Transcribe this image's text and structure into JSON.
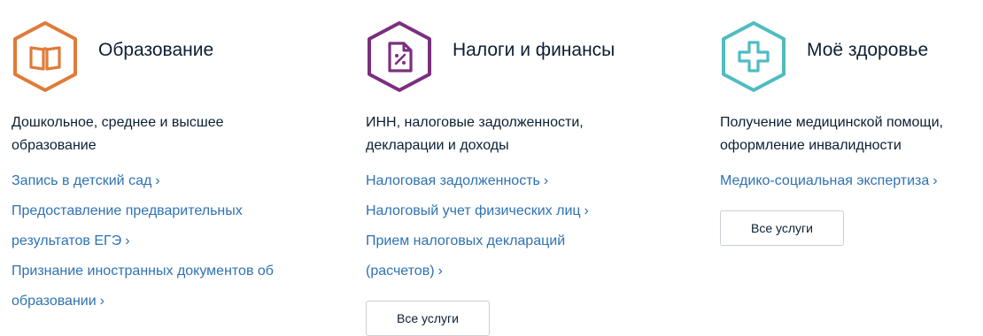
{
  "categories": [
    {
      "title": "Образование",
      "icon": "book-icon",
      "color": "#e07b39",
      "description": "Дошкольное, среднее и высшее образование",
      "links": [
        "Запись в детский сад",
        "Предоставление предварительных результатов ЕГЭ",
        "Признание иностранных документов об образовании"
      ]
    },
    {
      "title": "Налоги и финансы",
      "icon": "tax-document-icon",
      "color": "#7b2f7f",
      "description": "ИНН, налоговые задолженности, декларации и доходы",
      "links": [
        "Налоговая задолженность",
        "Налоговый учет физических лиц",
        "Прием налоговых деклараций (расчетов)"
      ],
      "button_label": "Все услуги"
    },
    {
      "title": "Моё здоровье",
      "icon": "medical-cross-icon",
      "color": "#4fbcc1",
      "description": "Получение медицинской помощи, оформление инвалидности",
      "links": [
        "Медико-социальная экспертиза"
      ],
      "button_label": "Все услуги"
    }
  ],
  "chevron": "›"
}
